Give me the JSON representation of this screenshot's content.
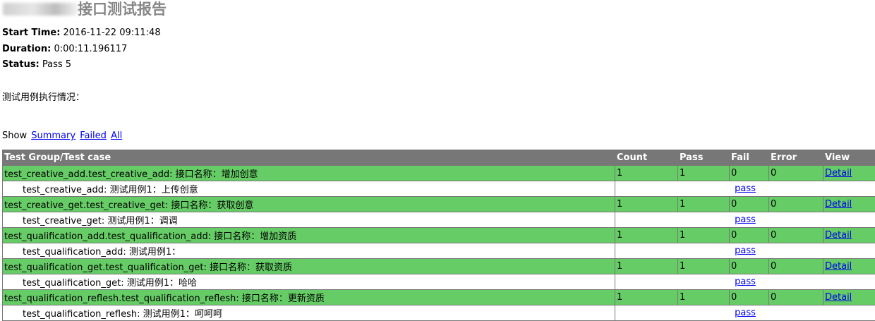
{
  "heading": {
    "title_suffix": "接口测试报告",
    "attributes": [
      {
        "label": "Start Time:",
        "value": "2016-11-22 09:11:48"
      },
      {
        "label": "Duration:",
        "value": "0:00:11.196117"
      },
      {
        "label": "Status:",
        "value": "Pass 5"
      }
    ]
  },
  "description": "测试用例执行情况：",
  "show_bar": {
    "label": "Show",
    "summary": "Summary",
    "failed": "Failed",
    "all": "All"
  },
  "table": {
    "headers": [
      "Test Group/Test case",
      "Count",
      "Pass",
      "Fail",
      "Error",
      "View"
    ],
    "groups": [
      {
        "name": "test_creative_add.test_creative_add: 接口名称：增加创意",
        "count": "1",
        "pass": "1",
        "fail": "0",
        "error": "0",
        "view": "Detail",
        "case": {
          "name": "test_creative_add: 测试用例1：上传创意",
          "status": "pass"
        }
      },
      {
        "name": "test_creative_get.test_creative_get: 接口名称：获取创意",
        "count": "1",
        "pass": "1",
        "fail": "0",
        "error": "0",
        "view": "Detail",
        "case": {
          "name": "test_creative_get: 测试用例1：调调",
          "status": "pass"
        }
      },
      {
        "name": "test_qualification_add.test_qualification_add: 接口名称：增加资质",
        "count": "1",
        "pass": "1",
        "fail": "0",
        "error": "0",
        "view": "Detail",
        "case": {
          "name": "test_qualification_add: 测试用例1：",
          "status": "pass"
        }
      },
      {
        "name": "test_qualification_get.test_qualification_get: 接口名称：获取资质",
        "count": "1",
        "pass": "1",
        "fail": "0",
        "error": "0",
        "view": "Detail",
        "case": {
          "name": "test_qualification_get: 测试用例1：哈哈",
          "status": "pass"
        }
      },
      {
        "name": "test_qualification_reflesh.test_qualification_reflesh: 接口名称：更新资质",
        "count": "1",
        "pass": "1",
        "fail": "0",
        "error": "0",
        "view": "Detail",
        "case": {
          "name": "test_qualification_reflesh: 测试用例1：呵呵呵",
          "status": "pass"
        }
      }
    ]
  },
  "colors": {
    "header_bg": "#777777",
    "pass_class_bg": "#66cc66",
    "link": "#0000ee",
    "title": "#888888"
  }
}
